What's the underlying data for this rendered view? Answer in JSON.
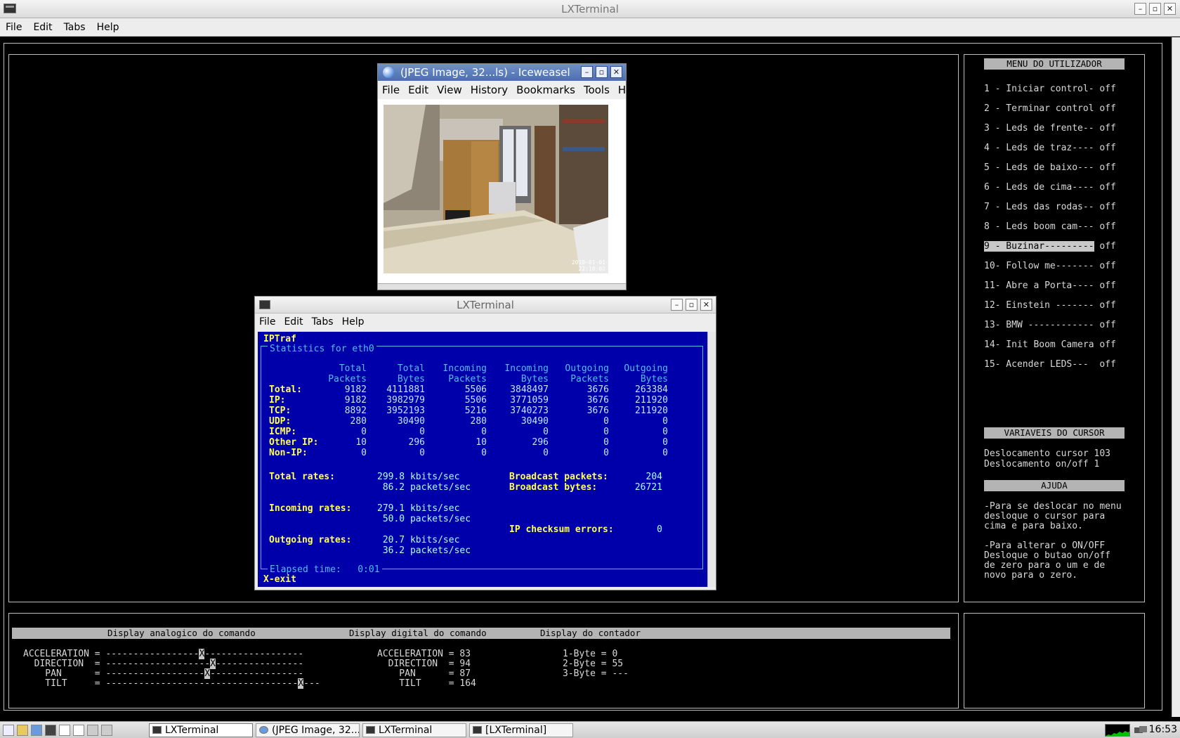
{
  "main_window": {
    "title": "LXTerminal",
    "menu": [
      "File",
      "Edit",
      "Tabs",
      "Help"
    ],
    "controls": {
      "minimize": "–",
      "maximize": "▫",
      "close": "✕"
    }
  },
  "right_panel": {
    "menu_header": "MENU DO UTILIZADOR",
    "items": [
      "1 - Iniciar control- off",
      "2 - Terminar control off",
      "3 - Leds de frente-- off",
      "4 - Leds de traz---- off",
      "5 - Leds de baixo--- off",
      "6 - Leds de cima---- off",
      "7 - Leds das rodas-- off",
      "8 - Leds boom cam--- off",
      "9 - Buzinar---------",
      "10- Follow me------- off",
      "11- Abre a Porta---- off",
      "12- Einstein ------- off",
      "13- BMW ------------ off",
      "14- Init Boom Camera off",
      "15- Acender LEDS---  off"
    ],
    "selected_suffix": " off",
    "cursor_header": "VARIAVEIS DO CURSOR",
    "cursor_lines": [
      "Deslocamento cursor 103",
      "Deslocamento on/off 1"
    ],
    "help_header": "AJUDA",
    "help_lines": [
      "-Para se deslocar no menu",
      "desloque o cursor para",
      "cima e para baixo.",
      "",
      "-Para alterar o ON/OFF",
      "Desloque o butao on/off",
      "de zero para o um e de",
      "novo para o zero."
    ]
  },
  "bottom_panel": {
    "headers": {
      "analog": "Display analogico do comando",
      "digital": "Display digital do comando",
      "counter": "Display do contador"
    },
    "analog_rows": [
      {
        "label": "ACCELERATION =",
        "left": "-----------------",
        "mark": "X",
        "right": "------------------"
      },
      {
        "label": "  DIRECTION  =",
        "left": "-------------------",
        "mark": "X",
        "right": "----------------"
      },
      {
        "label": "    PAN      =",
        "left": "------------------",
        "mark": "X",
        "right": "-----------------"
      },
      {
        "label": "    TILT     =",
        "left": "-----------------------------------",
        "mark": "X",
        "right": "---"
      }
    ],
    "digital_rows": [
      "ACCELERATION = 83",
      "  DIRECTION  = 94",
      "    PAN      = 87",
      "    TILT     = 164"
    ],
    "counter_rows": [
      "1-Byte = 0",
      "2-Byte = 55",
      "3-Byte = ---"
    ]
  },
  "iceweasel": {
    "title": "(JPEG Image, 32...ls) - Iceweasel",
    "menu": [
      "File",
      "Edit",
      "View",
      "History",
      "Bookmarks",
      "Tools",
      "Hel"
    ],
    "photo_stamp": [
      "2010-01-01",
      "22:18:02"
    ],
    "controls": {
      "minimize": "–",
      "maximize": "▫",
      "close": "✕"
    }
  },
  "lxterminal_small": {
    "title": "LXTerminal",
    "menu": [
      "File",
      "Edit",
      "Tabs",
      "Help"
    ],
    "controls": {
      "minimize": "–",
      "maximize": "▫",
      "close": "✕"
    }
  },
  "iptraf": {
    "app": "IPTraf",
    "box_title": "Statistics for eth0",
    "columns": [
      [
        "Total",
        "Packets"
      ],
      [
        "Total",
        "Bytes"
      ],
      [
        "Incoming",
        "Packets"
      ],
      [
        "Incoming",
        "Bytes"
      ],
      [
        "Outgoing",
        "Packets"
      ],
      [
        "Outgoing",
        "Bytes"
      ]
    ],
    "rows": [
      {
        "label": "Total:",
        "values": [
          "9182",
          "4111881",
          "5506",
          "3848497",
          "3676",
          "263384"
        ]
      },
      {
        "label": "IP:",
        "values": [
          "9182",
          "3982979",
          "5506",
          "3771059",
          "3676",
          "211920"
        ]
      },
      {
        "label": "TCP:",
        "values": [
          "8892",
          "3952193",
          "5216",
          "3740273",
          "3676",
          "211920"
        ]
      },
      {
        "label": "UDP:",
        "values": [
          "280",
          "30490",
          "280",
          "30490",
          "0",
          "0"
        ]
      },
      {
        "label": "ICMP:",
        "values": [
          "0",
          "0",
          "0",
          "0",
          "0",
          "0"
        ]
      },
      {
        "label": "Other IP:",
        "values": [
          "10",
          "296",
          "10",
          "296",
          "0",
          "0"
        ]
      },
      {
        "label": "Non-IP:",
        "values": [
          "0",
          "0",
          "0",
          "0",
          "0",
          "0"
        ]
      }
    ],
    "total_rates_label": "Total rates:",
    "total_rates": [
      "299.8 kbits/sec",
      " 86.2 packets/sec"
    ],
    "incoming_rates_label": "Incoming rates:",
    "incoming_rates": [
      "279.1 kbits/sec",
      " 50.0 packets/sec"
    ],
    "outgoing_rates_label": "Outgoing rates:",
    "outgoing_rates": [
      " 20.7 kbits/sec",
      " 36.2 packets/sec"
    ],
    "broadcast_packets_label": "Broadcast packets:",
    "broadcast_packets": "204",
    "broadcast_bytes_label": "Broadcast bytes:",
    "broadcast_bytes": "26721",
    "checksum_label": "IP checksum errors:",
    "checksum": "0",
    "elapsed": "Elapsed time:   0:01",
    "exit": "X-exit"
  },
  "taskbar": {
    "tasks": [
      "LXTerminal",
      "(JPEG Image, 32...",
      "LXTerminal",
      "[LXTerminal]"
    ],
    "clock": "16:53"
  },
  "colors": {
    "iptraf_bg": "#0000aa",
    "iptraf_yellow": "#ffff55",
    "iptraf_cyan": "#55bbee",
    "terminal_fg": "#d8d8d8"
  }
}
